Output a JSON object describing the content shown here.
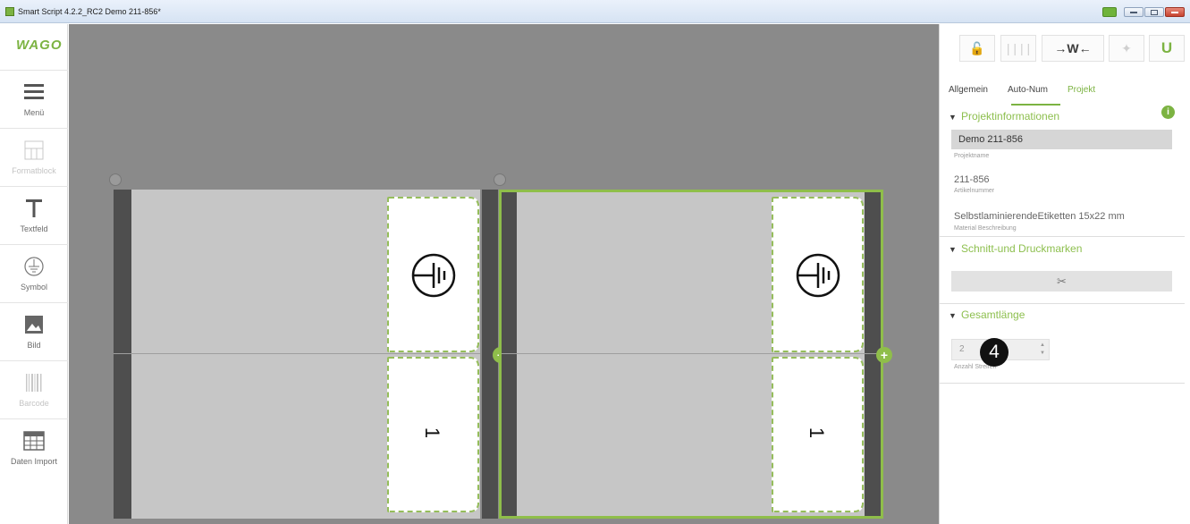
{
  "window": {
    "title": "Smart Script 4.2.2_RC2  Demo 211-856*"
  },
  "toolbar": {
    "logo": "WAGO",
    "items": [
      {
        "label": "Menü",
        "icon": "menu-icon",
        "enabled": true
      },
      {
        "label": "Formatblock",
        "icon": "format-block-icon",
        "enabled": false
      },
      {
        "label": "Textfeld",
        "icon": "text-field-icon",
        "enabled": true
      },
      {
        "label": "Symbol",
        "icon": "ground-symbol-icon",
        "enabled": true
      },
      {
        "label": "Bild",
        "icon": "image-icon",
        "enabled": true
      },
      {
        "label": "Barcode",
        "icon": "barcode-icon",
        "enabled": false
      },
      {
        "label": "Daten Import",
        "icon": "table-import-icon",
        "enabled": true
      }
    ]
  },
  "canvas": {
    "labels": [
      {
        "number": "1",
        "symbol": "protective-earth-icon",
        "selected": false
      },
      {
        "number": "1",
        "symbol": "protective-earth-icon",
        "selected": true
      }
    ]
  },
  "panel": {
    "top_buttons": [
      {
        "icon": "unlock-icon",
        "active": false
      },
      {
        "icon": "columns-icon",
        "active": false
      },
      {
        "icon": "fit-width-icon",
        "label": "→W←",
        "active": true
      },
      {
        "icon": "magic-wand-icon",
        "active": false
      },
      {
        "icon": "magnet-icon",
        "active": true
      }
    ],
    "tabs": [
      "Allgemein",
      "Auto-Num",
      "Projekt"
    ],
    "active_tab": "Projekt",
    "sections": {
      "projektinfo": {
        "title": "Projektinformationen",
        "project_name_value": "Demo 211-856",
        "project_name_caption": "Projektname",
        "article_value": "211-856",
        "article_caption": "Artikelnummer",
        "material_value": "SelbstlaminierendeEtiketten 15x22 mm",
        "material_caption": "Material Beschreibung"
      },
      "marks": {
        "title": "Schnitt-und Druckmarken",
        "button_icon": "scissors-icon"
      },
      "length": {
        "title": "Gesamtlänge",
        "value": "2",
        "caption": "Anzahl Streifen"
      }
    },
    "callout": "4"
  },
  "colors": {
    "accent_green": "#7cb342",
    "canvas_gray": "#8a8a8a"
  }
}
